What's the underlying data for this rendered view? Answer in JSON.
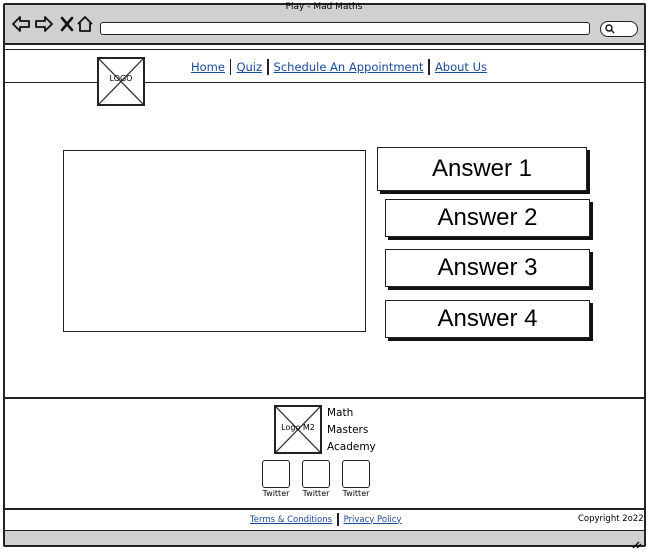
{
  "window": {
    "title": "Play - Mad Maths"
  },
  "browser": {
    "back_icon": "back-arrow-icon",
    "forward_icon": "forward-arrow-icon",
    "stop_icon": "close-icon",
    "home_icon": "home-icon",
    "search_icon": "search-icon"
  },
  "header": {
    "logo_label": "LOGO",
    "nav": [
      {
        "label": "Home"
      },
      {
        "label": "Quiz"
      },
      {
        "label": "Schedule An Appointment"
      },
      {
        "label": "About Us"
      }
    ]
  },
  "answers": [
    {
      "label": "Answer 1"
    },
    {
      "label": "Answer 2"
    },
    {
      "label": "Answer 3"
    },
    {
      "label": "Answer 4"
    }
  ],
  "footer": {
    "logo_label": "Logo M2",
    "academy_lines": [
      "Math",
      "Masters",
      "Academy"
    ],
    "social": [
      {
        "label": "Twitter"
      },
      {
        "label": "Twitter"
      },
      {
        "label": "Twitter"
      }
    ],
    "legal": {
      "terms": "Terms & Conditions",
      "privacy": "Privacy Policy"
    },
    "copyright": "Copyright 2o22"
  }
}
